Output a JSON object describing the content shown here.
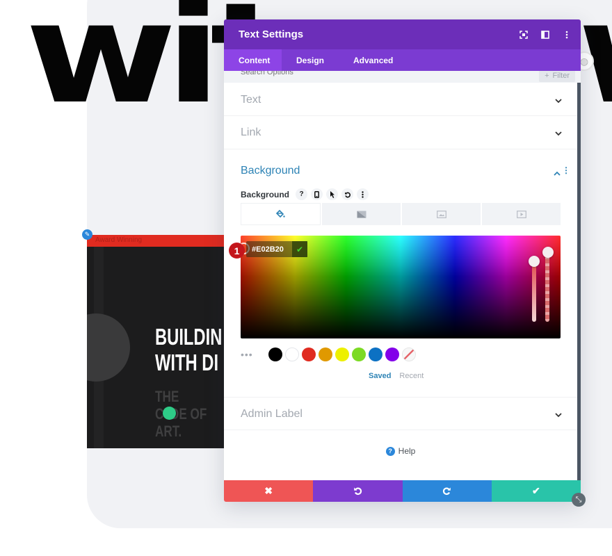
{
  "background": {
    "headline_left": "wit",
    "headline_right": "w",
    "card": {
      "topbar_text": "Award Winning",
      "title_line1": "BUILDIN",
      "title_line2": "WITH DI",
      "sub_line1": "THE",
      "sub_line2": "C  DE OF",
      "sub_line3": "ART.",
      "accent_dot_color": "#2ecc87",
      "topbar_color": "#e02b20"
    }
  },
  "modal": {
    "title": "Text Settings",
    "header_icons": [
      "focus-mode-icon",
      "split-view-icon",
      "more-options-icon"
    ],
    "tabs": [
      {
        "label": "Content",
        "active": true
      },
      {
        "label": "Design",
        "active": false
      },
      {
        "label": "Advanced",
        "active": false
      }
    ],
    "search": {
      "placeholder": "Search Options",
      "filter_label": "Filter"
    },
    "sections": {
      "text": {
        "label": "Text",
        "expanded": false
      },
      "link": {
        "label": "Link",
        "expanded": false
      },
      "background": {
        "label": "Background",
        "expanded": true,
        "field_label": "Background",
        "field_tools": [
          "?",
          "mobile",
          "pointer",
          "reset",
          "more"
        ],
        "type_tabs": [
          "color",
          "gradient",
          "image",
          "video"
        ],
        "active_type": "color",
        "picker": {
          "hex_value": "#E02B20",
          "step_marker": "1",
          "hue_slider": 0.96,
          "opacity_slider": 1.0
        },
        "swatches": [
          "#000000",
          "#ffffff",
          "#e02b20",
          "#e09900",
          "#edf000",
          "#7cda24",
          "#0c71c3",
          "#8300e9",
          "none"
        ],
        "swatch_tabs": {
          "saved": "Saved",
          "recent": "Recent",
          "active": "saved"
        }
      },
      "admin_label": {
        "label": "Admin Label",
        "expanded": false
      }
    },
    "help_label": "Help",
    "footer": {
      "cancel": "✖",
      "undo": "↺",
      "redo": "↻",
      "save": "✔"
    }
  }
}
